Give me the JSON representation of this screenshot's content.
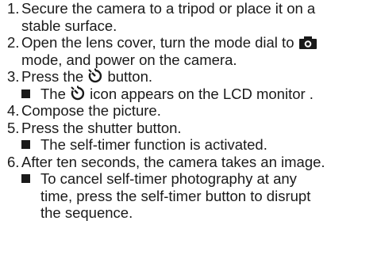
{
  "steps": [
    {
      "num": "1.",
      "line1": "Secure the camera to a tripod or place it on a",
      "line2": "stable surface."
    },
    {
      "num": "2.",
      "line1a": "Open the lens cover, turn the mode dial to",
      "line2": "mode, and power on the camera.",
      "icon": "camera-icon"
    },
    {
      "num": "3.",
      "a": "Press the",
      "b": "button.",
      "icon": "self-timer-icon",
      "note": {
        "a": "The",
        "b": "icon appears on the LCD monitor ."
      }
    },
    {
      "num": "4.",
      "text": "Compose the picture."
    },
    {
      "num": "5.",
      "text": "Press the shutter button.",
      "note": {
        "text": "The self-timer function is activated."
      }
    },
    {
      "num": "6.",
      "text": "After ten seconds, the camera takes an image.",
      "note": {
        "lines": [
          "To cancel self-timer photography at any",
          "time, press the self-timer button to disrupt",
          "the sequence."
        ]
      }
    }
  ]
}
